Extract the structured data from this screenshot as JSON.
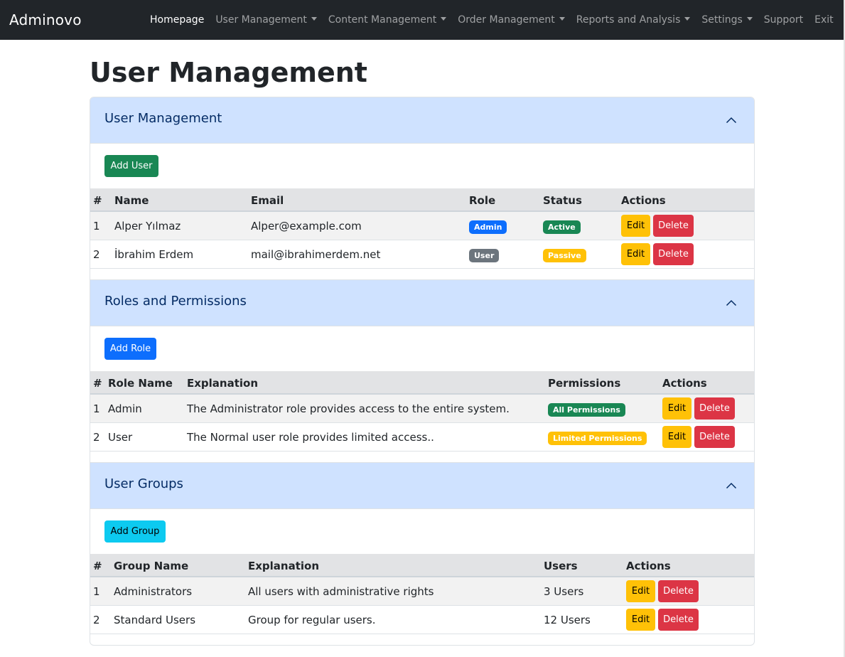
{
  "navbar": {
    "brand": "Adminovo",
    "items": [
      {
        "label": "Homepage"
      },
      {
        "label": "User Management"
      },
      {
        "label": "Content Management"
      },
      {
        "label": "Order Management"
      },
      {
        "label": "Reports and Analysis"
      },
      {
        "label": "Settings"
      },
      {
        "label": "Support"
      },
      {
        "label": "Exit"
      }
    ]
  },
  "page": {
    "title": "User Management"
  },
  "colors": {
    "navbar_bg": "#212529",
    "accordion_header_bg": "#cfe2ff",
    "success": "#198754",
    "primary": "#0d6efd",
    "info": "#0dcaf0",
    "warning": "#ffc107",
    "danger": "#dc3545",
    "secondary": "#6c757d"
  },
  "sections": {
    "users": {
      "title": "User Management",
      "icon": "chevron-up-icon",
      "add_button": "Add User",
      "headers": [
        "#",
        "Name",
        "Email",
        "Role",
        "Status",
        "Actions"
      ],
      "rows": [
        {
          "num": "1",
          "name": "Alper Yılmaz",
          "email": "Alper@example.com",
          "role": "Admin",
          "status": "Active",
          "edit": "Edit",
          "delete": "Delete"
        },
        {
          "num": "2",
          "name": "İbrahim Erdem",
          "email": "mail@ibrahimerdem.net",
          "role": "User",
          "status": "Passive",
          "edit": "Edit",
          "delete": "Delete"
        }
      ]
    },
    "roles": {
      "title": "Roles and Permissions",
      "icon": "chevron-up-icon",
      "add_button": "Add Role",
      "headers": [
        "#",
        "Role Name",
        "Explanation",
        "Permissions",
        "Actions"
      ],
      "rows": [
        {
          "num": "1",
          "name": "Admin",
          "explanation": "The Administrator role provides access to the entire system.",
          "permissions": "All Permissions",
          "edit": "Edit",
          "delete": "Delete"
        },
        {
          "num": "2",
          "name": "User",
          "explanation": "The Normal user role provides limited access..",
          "permissions": "Limited Permissions",
          "edit": "Edit",
          "delete": "Delete"
        }
      ]
    },
    "groups": {
      "title": "User Groups",
      "icon": "chevron-up-icon",
      "add_button": "Add Group",
      "headers": [
        "#",
        "Group Name",
        "Explanation",
        "Users",
        "Actions"
      ],
      "rows": [
        {
          "num": "1",
          "name": "Administrators",
          "explanation": "All users with administrative rights",
          "users": "3 Users",
          "edit": "Edit",
          "delete": "Delete"
        },
        {
          "num": "2",
          "name": "Standard Users",
          "explanation": "Group for regular users.",
          "users": "12 Users",
          "edit": "Edit",
          "delete": "Delete"
        }
      ]
    }
  }
}
